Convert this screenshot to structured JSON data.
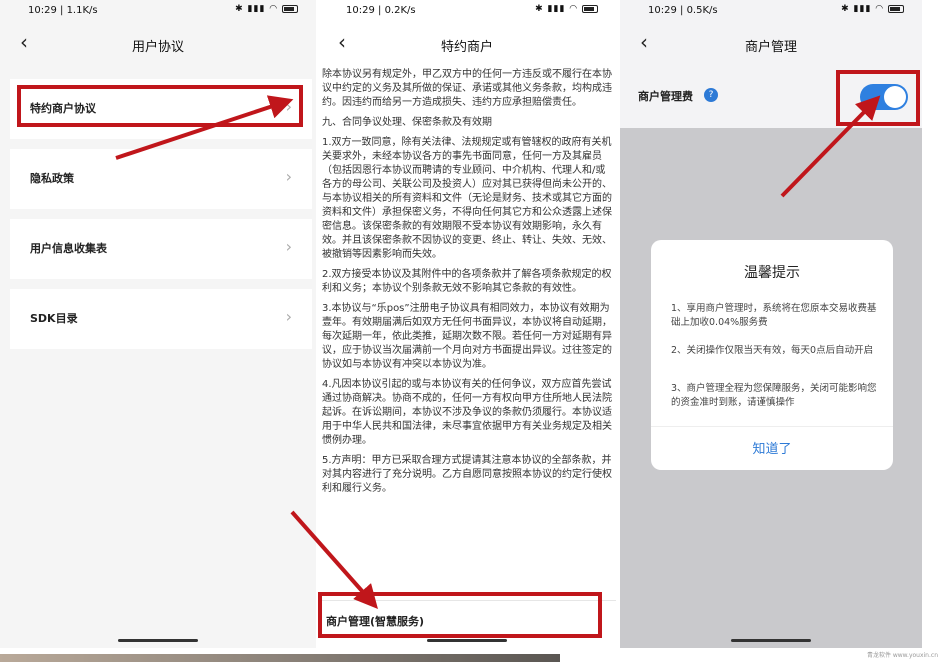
{
  "status_bar": [
    {
      "time": "10:29",
      "speed": "1.1K/s"
    },
    {
      "time": "10:29",
      "speed": "0.2K/s"
    },
    {
      "time": "10:29",
      "speed": "0.5K/s"
    }
  ],
  "panel1": {
    "title": "用户协议",
    "items": [
      {
        "label": "特约商户协议"
      },
      {
        "label": "隐私政策"
      },
      {
        "label": "用户信息收集表"
      },
      {
        "label": "SDK目录"
      }
    ]
  },
  "panel2": {
    "title": "特约商户",
    "paragraphs": [
      "除本协议另有规定外，甲乙双方中的任何一方违反或不履行在本协议中约定的义务及其所做的保证、承诺或其他义务条款，均构成违约。因违约而给另一方造成损失、违约方应承担赔偿责任。",
      "九、合同争议处理、保密条款及有效期",
      "1.双方一致同意，除有关法律、法规规定或有管辖权的政府有关机关要求外，未经本协议各方的事先书面同意，任何一方及其雇员（包括因恩行本协议而聘请的专业顾问、中介机构、代理人和/或各方的母公司、关联公司及投资人）应对其已获得但尚未公开的、与本协议相关的所有资料和文件（无论是财务、技术或其它方面的资料和文件）承担保密义务，不得向任何其它方和公众透露上述保密信息。该保密条款的有效期限不受本协议有效期影响，永久有效。并且该保密条款不因协议的变更、终止、转让、失效、无效、被撤销等因素影响而失效。",
      "2.双方接受本协议及其附件中的各项条款并了解各项条款规定的权利和义务；本协议个别条款无效不影响其它条款的有效性。",
      "3.本协议与“乐pos”注册电子协议具有相同效力，本协议有效期为壹年。有效期届满后如双方无任何书面异议，本协议将自动延期，每次延期一年，依此类推，延期次数不限。若任何一方对延期有异议，应于协议当次届满前一个月向对方书面提出异议。过往签定的协议如与本协议有冲突以本协议为准。",
      "4.凡因本协议引起的或与本协议有关的任何争议，双方应首先尝试通过协商解决。协商不成的，任何一方有权向甲方住所地人民法院起诉。在诉讼期间，本协议不涉及争议的条款仍须履行。本协议适用于中华人民共和国法律，未尽事宜依据甲方有关业务规定及相关惯例办理。",
      "5.方声明：甲方已采取合理方式提请其注意本协议的全部条款，并对其内容进行了充分说明。乙方自愿同意按照本协议的约定行使权利和履行义务。"
    ],
    "bottom_item": "商户管理(智慧服务)"
  },
  "panel3": {
    "title": "商户管理",
    "setting_label": "商户管理费",
    "help": "?",
    "toggle_on": true,
    "dialog": {
      "title": "温馨提示",
      "items": [
        "1、享用商户管理时，系统将在您原本交易收费基础上加收0.04%服务费",
        "2、关闭操作仅限当天有效，每天0点后自动开启",
        "3、商户管理全程为您保障服务，关闭可能影响您的资金准时到账，请谨慎操作"
      ],
      "button": "知道了"
    }
  },
  "watermark": "青龙软件 www.youxin.cn",
  "colors": {
    "highlight": "#c0161b",
    "accent": "#2f80e0"
  }
}
